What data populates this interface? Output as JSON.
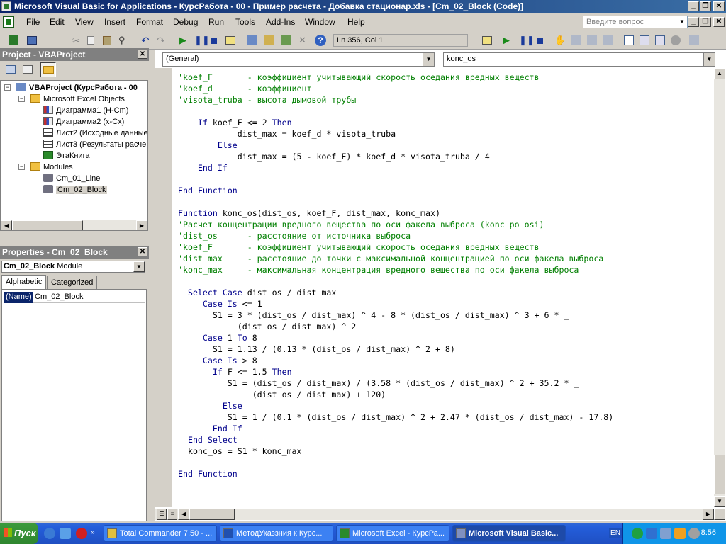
{
  "window": {
    "title": "Microsoft Visual Basic for Applications - КурсРабота - 00 - Пример расчета - Добавка стационар.xls - [Cm_02_Block (Code)]"
  },
  "menu": {
    "items": [
      "File",
      "Edit",
      "View",
      "Insert",
      "Format",
      "Debug",
      "Run",
      "Tools",
      "Add-Ins",
      "Window",
      "Help"
    ],
    "ask_placeholder": "Введите вопрос"
  },
  "toolbar": {
    "position": "Ln 356, Col 1"
  },
  "project": {
    "title": "Project - VBAProject",
    "root": "VBAProject (КурсРабота - 00",
    "excel_objects": "Microsoft Excel Objects",
    "sheets": [
      "Диаграмма1 (Н-Cm)",
      "Диаграмма2 (x-Cx)",
      "Лист2 (Исходные данные",
      "Лист3 (Результаты расче",
      "ЭтаКнига"
    ],
    "modules_label": "Modules",
    "modules": [
      "Cm_01_Line",
      "Cm_02_Block"
    ]
  },
  "properties": {
    "title": "Properties - Cm_02_Block",
    "object": "Cm_02_Block",
    "object_type": "Module",
    "tab_alpha": "Alphabetic",
    "tab_cat": "Categorized",
    "row_name": "(Name)",
    "row_value": "Cm_02_Block"
  },
  "code": {
    "object_combo": "(General)",
    "proc_combo": "konc_os",
    "lines": [
      {
        "t": "'koef_F       - коэффициент учитывающий скорость оседания вредных веществ",
        "c": "c"
      },
      {
        "t": "'koef_d       - коэффициент",
        "c": "c"
      },
      {
        "t": "'visota_truba - высота дымовой трубы",
        "c": "c"
      },
      {
        "t": "",
        "c": ""
      },
      {
        "t": "    If koef_F <= 2 Then",
        "c": "k"
      },
      {
        "t": "            dist_max = koef_d * visota_truba",
        "c": ""
      },
      {
        "t": "        Else",
        "c": "k"
      },
      {
        "t": "            dist_max = (5 - koef_F) * koef_d * visota_truba / 4",
        "c": ""
      },
      {
        "t": "    End If",
        "c": "k"
      },
      {
        "t": "",
        "c": ""
      },
      {
        "t": "End Function",
        "c": "k"
      },
      {
        "t": "",
        "c": ""
      },
      {
        "t": "Function konc_os(dist_os, koef_F, dist_max, konc_max)",
        "c": "kf"
      },
      {
        "t": "'Расчет концентрации вредного вещества по оси факела выброса (konc_po_osi)",
        "c": "c"
      },
      {
        "t": "'dist_os      - расстояние от источника выброса",
        "c": "c"
      },
      {
        "t": "'koef_F       - коэффициент учитывающий скорость оседания вредных веществ",
        "c": "c"
      },
      {
        "t": "'dist_max     - расстояние до точки с максимальной концентрацией по оси факела выброса",
        "c": "c"
      },
      {
        "t": "'konc_max     - максимальная концентрация вредного вещества по оси факела выброса",
        "c": "c"
      },
      {
        "t": "",
        "c": ""
      },
      {
        "t": "  Select Case dist_os / dist_max",
        "c": "k"
      },
      {
        "t": "     Case Is <= 1",
        "c": "k"
      },
      {
        "t": "       S1 = 3 * (dist_os / dist_max) ^ 4 - 8 * (dist_os / dist_max) ^ 3 + 6 * _",
        "c": ""
      },
      {
        "t": "            (dist_os / dist_max) ^ 2",
        "c": ""
      },
      {
        "t": "     Case 1 To 8",
        "c": "k"
      },
      {
        "t": "       S1 = 1.13 / (0.13 * (dist_os / dist_max) ^ 2 + 8)",
        "c": ""
      },
      {
        "t": "     Case Is > 8",
        "c": "k"
      },
      {
        "t": "       If F <= 1.5 Then",
        "c": "k"
      },
      {
        "t": "          S1 = (dist_os / dist_max) / (3.58 * (dist_os / dist_max) ^ 2 + 35.2 * _",
        "c": ""
      },
      {
        "t": "               (dist_os / dist_max) + 120)",
        "c": ""
      },
      {
        "t": "         Else",
        "c": "k"
      },
      {
        "t": "          S1 = 1 / (0.1 * (dist_os / dist_max) ^ 2 + 2.47 * (dist_os / dist_max) - 17.8)",
        "c": ""
      },
      {
        "t": "       End If",
        "c": "k"
      },
      {
        "t": "  End Select",
        "c": "k"
      },
      {
        "t": "  konc_os = S1 * konc_max",
        "c": ""
      },
      {
        "t": "",
        "c": ""
      },
      {
        "t": "End Function",
        "c": "k"
      }
    ]
  },
  "taskbar": {
    "start": "Пуск",
    "tasks": [
      "Total Commander 7.50 - ...",
      "МетодУказзния к Курс...",
      "Microsoft Excel - КурсРа...",
      "Microsoft Visual Basic..."
    ],
    "lang": "EN",
    "clock": "8:56"
  }
}
